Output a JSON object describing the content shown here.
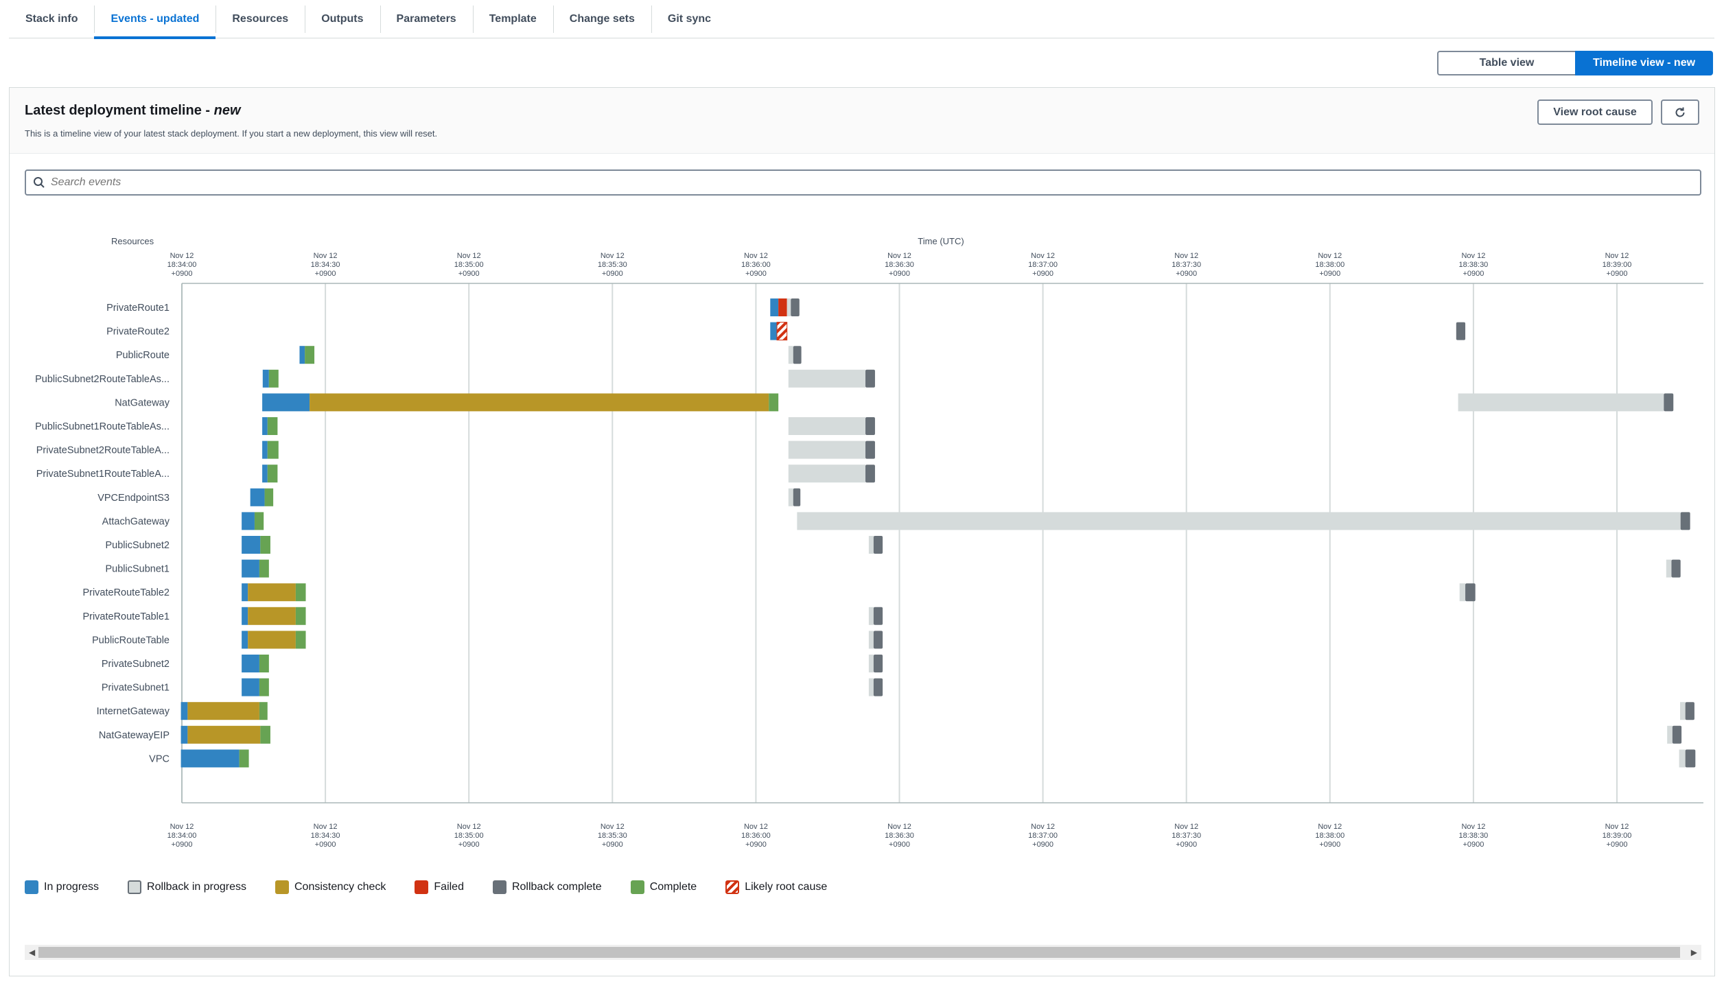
{
  "tabs": [
    {
      "label": "Stack info",
      "active": false
    },
    {
      "label": "Events - updated",
      "active": true
    },
    {
      "label": "Resources",
      "active": false
    },
    {
      "label": "Outputs",
      "active": false
    },
    {
      "label": "Parameters",
      "active": false
    },
    {
      "label": "Template",
      "active": false
    },
    {
      "label": "Change sets",
      "active": false
    },
    {
      "label": "Git sync",
      "active": false
    }
  ],
  "view_toggle": {
    "table": "Table view",
    "timeline": "Timeline view - new",
    "selected": "timeline"
  },
  "panel": {
    "title": "Latest deployment timeline - ",
    "title_em": "new",
    "subtitle": "This is a timeline view of your latest stack deployment. If you start a new deployment, this view will reset.",
    "root_cause_button": "View root cause",
    "refresh_icon": "refresh-icon"
  },
  "search": {
    "placeholder": "Search events",
    "value": ""
  },
  "colors": {
    "in_progress": "#3184c2",
    "rollback_in_progress": "#d5dbdb",
    "consistency_check": "#b89627",
    "failed": "#d13212",
    "rollback_complete": "#687078",
    "complete": "#67a353",
    "root_cause": "#d13212",
    "accent": "#0972d3"
  },
  "chart_data": {
    "type": "timeline",
    "y_axis_label": "Resources",
    "x_axis_label": "Time (UTC)",
    "x_range_seconds": [
      0,
      324
    ],
    "x_origin": "Nov 12 18:34:00 +0900",
    "ticks": [
      {
        "d": "Nov 12",
        "t": "18:34:00",
        "z": "+0900"
      },
      {
        "d": "Nov 12",
        "t": "18:34:30",
        "z": "+0900"
      },
      {
        "d": "Nov 12",
        "t": "18:35:00",
        "z": "+0900"
      },
      {
        "d": "Nov 12",
        "t": "18:35:30",
        "z": "+0900"
      },
      {
        "d": "Nov 12",
        "t": "18:36:00",
        "z": "+0900"
      },
      {
        "d": "Nov 12",
        "t": "18:36:30",
        "z": "+0900"
      },
      {
        "d": "Nov 12",
        "t": "18:37:00",
        "z": "+0900"
      },
      {
        "d": "Nov 12",
        "t": "18:37:30",
        "z": "+0900"
      },
      {
        "d": "Nov 12",
        "t": "18:38:00",
        "z": "+0900"
      },
      {
        "d": "Nov 12",
        "t": "18:38:30",
        "z": "+0900"
      },
      {
        "d": "Nov 12",
        "t": "18:39:00",
        "z": "+0900"
      }
    ],
    "resources": [
      {
        "name": "PrivateRoute1",
        "segments": [
          [
            "ip",
            123.0,
            124.7
          ],
          [
            "fail",
            124.7,
            126.5
          ],
          [
            "rbip",
            126.5,
            127.3
          ],
          [
            "rbc",
            127.3,
            129.1
          ]
        ]
      },
      {
        "name": "PrivateRoute2",
        "segments": [
          [
            "ip",
            123.0,
            124.4
          ],
          [
            "root",
            124.4,
            126.5
          ],
          [
            "rbc",
            266.4,
            268.3
          ]
        ]
      },
      {
        "name": "PublicRoute",
        "segments": [
          [
            "ip",
            24.6,
            25.7
          ],
          [
            "c",
            25.7,
            27.7
          ],
          [
            "rbip",
            126.8,
            127.8
          ],
          [
            "rbc",
            127.8,
            129.5
          ]
        ]
      },
      {
        "name": "PublicSubnet2RouteTableAs...",
        "segments": [
          [
            "ip",
            16.9,
            18.2
          ],
          [
            "c",
            18.2,
            20.2
          ],
          [
            "rbip",
            126.8,
            142.9
          ],
          [
            "rbc",
            142.9,
            144.9
          ]
        ]
      },
      {
        "name": "NatGateway",
        "segments": [
          [
            "ip",
            16.8,
            26.7
          ],
          [
            "cc",
            26.7,
            122.7
          ],
          [
            "c",
            122.7,
            124.7
          ],
          [
            "rbip",
            266.8,
            309.8
          ],
          [
            "rbc",
            309.8,
            311.8
          ]
        ]
      },
      {
        "name": "PublicSubnet1RouteTableAs...",
        "segments": [
          [
            "ip",
            16.8,
            17.9
          ],
          [
            "c",
            17.9,
            20.0
          ],
          [
            "rbip",
            126.8,
            142.9
          ],
          [
            "rbc",
            142.9,
            144.9
          ]
        ]
      },
      {
        "name": "PrivateSubnet2RouteTableA...",
        "segments": [
          [
            "ip",
            16.8,
            17.9
          ],
          [
            "c",
            17.9,
            20.2
          ],
          [
            "rbip",
            126.8,
            142.9
          ],
          [
            "rbc",
            142.9,
            144.9
          ]
        ]
      },
      {
        "name": "PrivateSubnet1RouteTableA...",
        "segments": [
          [
            "ip",
            16.8,
            17.9
          ],
          [
            "c",
            17.9,
            20.0
          ],
          [
            "rbip",
            126.8,
            142.9
          ],
          [
            "rbc",
            142.9,
            144.9
          ]
        ]
      },
      {
        "name": "VPCEndpointS3",
        "segments": [
          [
            "ip",
            14.3,
            17.3
          ],
          [
            "c",
            17.3,
            19.1
          ],
          [
            "rbip",
            126.8,
            127.8
          ],
          [
            "rbc",
            127.8,
            129.3
          ]
        ]
      },
      {
        "name": "AttachGateway",
        "segments": [
          [
            "ip",
            12.5,
            15.2
          ],
          [
            "c",
            15.2,
            17.1
          ],
          [
            "rbip",
            128.6,
            313.3
          ],
          [
            "rbc",
            313.3,
            315.3
          ]
        ]
      },
      {
        "name": "PublicSubnet2",
        "segments": [
          [
            "ip",
            12.5,
            16.4
          ],
          [
            "c",
            16.4,
            18.5
          ],
          [
            "rbip",
            143.6,
            144.6
          ],
          [
            "rbc",
            144.6,
            146.5
          ]
        ]
      },
      {
        "name": "PublicSubnet1",
        "segments": [
          [
            "ip",
            12.5,
            16.2
          ],
          [
            "c",
            16.2,
            18.2
          ],
          [
            "rbip",
            310.3,
            311.4
          ],
          [
            "rbc",
            311.4,
            313.3
          ]
        ]
      },
      {
        "name": "PrivateRouteTable2",
        "segments": [
          [
            "ip",
            12.5,
            13.8
          ],
          [
            "cc",
            13.8,
            23.8
          ],
          [
            "c",
            23.8,
            25.9
          ],
          [
            "rbip",
            267.1,
            268.3
          ],
          [
            "rbc",
            268.3,
            270.4
          ]
        ]
      },
      {
        "name": "PrivateRouteTable1",
        "segments": [
          [
            "ip",
            12.5,
            13.8
          ],
          [
            "cc",
            13.8,
            23.8
          ],
          [
            "c",
            23.8,
            25.9
          ],
          [
            "rbip",
            143.6,
            144.6
          ],
          [
            "rbc",
            144.6,
            146.5
          ]
        ]
      },
      {
        "name": "PublicRouteTable",
        "segments": [
          [
            "ip",
            12.5,
            13.8
          ],
          [
            "cc",
            13.8,
            23.8
          ],
          [
            "c",
            23.8,
            25.9
          ],
          [
            "rbip",
            143.6,
            144.6
          ],
          [
            "rbc",
            144.6,
            146.5
          ]
        ]
      },
      {
        "name": "PrivateSubnet2",
        "segments": [
          [
            "ip",
            12.5,
            16.2
          ],
          [
            "c",
            16.2,
            18.2
          ],
          [
            "rbip",
            143.6,
            144.6
          ],
          [
            "rbc",
            144.6,
            146.5
          ]
        ]
      },
      {
        "name": "PrivateSubnet1",
        "segments": [
          [
            "ip",
            12.5,
            16.2
          ],
          [
            "c",
            16.2,
            18.2
          ],
          [
            "rbip",
            143.6,
            144.6
          ],
          [
            "rbc",
            144.6,
            146.5
          ]
        ]
      },
      {
        "name": "InternetGateway",
        "segments": [
          [
            "ip",
            -0.2,
            1.2
          ],
          [
            "cc",
            1.2,
            16.2
          ],
          [
            "c",
            16.2,
            17.9
          ],
          [
            "rbip",
            313.2,
            314.3
          ],
          [
            "rbc",
            314.3,
            316.2
          ]
        ]
      },
      {
        "name": "NatGatewayEIP",
        "segments": [
          [
            "ip",
            -0.2,
            1.2
          ],
          [
            "cc",
            1.2,
            16.4
          ],
          [
            "c",
            16.4,
            18.5
          ],
          [
            "rbip",
            310.5,
            311.6
          ],
          [
            "rbc",
            311.6,
            313.5
          ]
        ]
      },
      {
        "name": "VPC",
        "segments": [
          [
            "ip",
            -0.2,
            12.0
          ],
          [
            "c",
            12.0,
            14.0
          ],
          [
            "rbip",
            313.0,
            314.3
          ],
          [
            "rbc",
            314.3,
            316.4
          ]
        ]
      }
    ]
  },
  "legend": [
    {
      "key": "ip",
      "label": "In progress"
    },
    {
      "key": "rbip",
      "label": "Rollback in progress"
    },
    {
      "key": "cc",
      "label": "Consistency check"
    },
    {
      "key": "fail",
      "label": "Failed"
    },
    {
      "key": "rbc",
      "label": "Rollback complete"
    },
    {
      "key": "c",
      "label": "Complete"
    },
    {
      "key": "root",
      "label": "Likely root cause"
    }
  ]
}
